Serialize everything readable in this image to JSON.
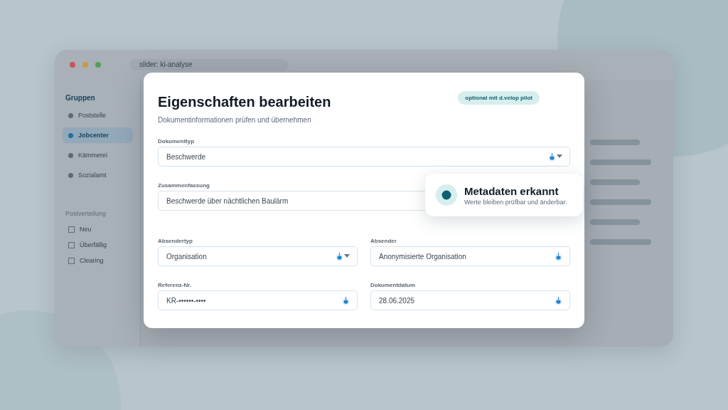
{
  "browser": {
    "address": "slider: ki-analyse"
  },
  "sidebar": {
    "groups_heading": "Gruppen",
    "groups": [
      {
        "label": "Poststelle",
        "selected": false
      },
      {
        "label": "Jobcenter",
        "selected": true
      },
      {
        "label": "Kämmerei",
        "selected": false
      },
      {
        "label": "Sozialamt",
        "selected": false
      }
    ],
    "distribution_heading": "Postverteilung",
    "distribution": [
      {
        "label": "Neu",
        "checked": false
      },
      {
        "label": "Überfällig",
        "checked": false
      },
      {
        "label": "Clearing",
        "checked": false
      }
    ]
  },
  "dialog": {
    "title": "Eigenschaften bearbeiten",
    "subtitle": "Dokumentinformationen prüfen und übernehmen",
    "badge": "optional mit d.velop pilot",
    "rows": [
      [
        {
          "label": "Dokumenttyp",
          "value": "Beschwerde",
          "kind": "select",
          "ai_detected": true
        }
      ],
      [
        {
          "label": "Zusammenfassung",
          "value": "Beschwerde über nächtlichen Baulärm",
          "kind": "text"
        }
      ],
      [
        {
          "label": "Absendertyp",
          "value": "Organisation",
          "kind": "select",
          "ai_detected": true
        },
        {
          "label": "Absender",
          "value": "Anonymisierte Organisation",
          "kind": "text",
          "ai_detected": true
        }
      ],
      [
        {
          "label": "Referenz-Nr.",
          "value": "KR-••••••-••••",
          "kind": "text",
          "ai_detected": true
        },
        {
          "label": "Dokumentdatum",
          "value": "28.06.2025",
          "kind": "text",
          "ai_detected": true
        }
      ]
    ]
  },
  "toast": {
    "title": "Metadaten erkannt",
    "text": "Werte bleiben prüfbar und änderbar."
  }
}
